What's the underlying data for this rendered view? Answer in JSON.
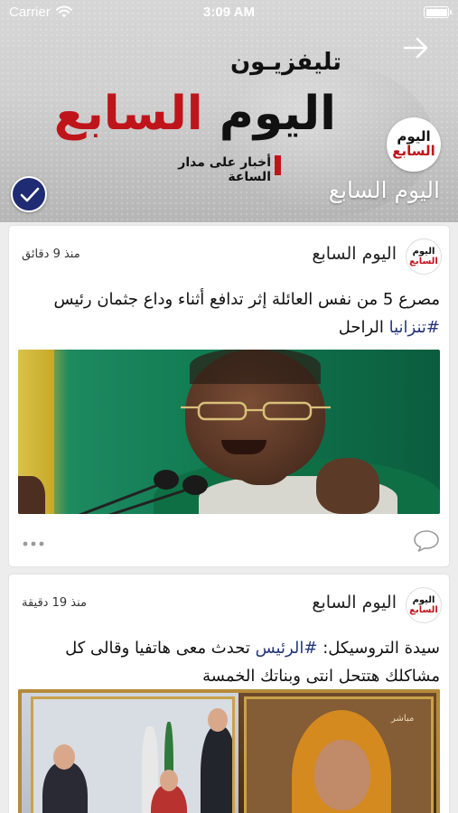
{
  "status_bar": {
    "carrier": "Carrier",
    "time": "3:09 AM"
  },
  "channel": {
    "cover": {
      "tv_label": "تليفزيـون",
      "brand_word_1": "اليوم",
      "brand_word_2": "السابع",
      "tagline": "أخبار على مدار الساعة"
    },
    "avatar_logo": {
      "line_1": "اليوم",
      "line_2": "السابع"
    },
    "name": "اليوم السابع",
    "verified_badge_color": "#1f2b72",
    "share_icon": "arrow-right-icon"
  },
  "posts": [
    {
      "author": "اليوم السابع",
      "avatar_logo": {
        "line_1": "اليوم",
        "line_2": "السابع"
      },
      "time_ago": "منذ 9 دقائق",
      "text": "مصرع 5 من نفس العائلة إثر تدافع أثناء وداع جثمان رئيس",
      "hashtag": "#تنزانيا",
      "text_after": "الراحل",
      "more_icon": "more-dots-icon",
      "comment_icon": "comment-bubble-icon"
    },
    {
      "author": "اليوم السابع",
      "avatar_logo": {
        "line_1": "اليوم",
        "line_2": "السابع"
      },
      "time_ago": "منذ 19 دقيقة",
      "text_before": "سيدة التروسيكل:",
      "hashtag": "#الرئيس",
      "text_after": "تحدث معى هاتفيا وقالى كل مشاكلك هتتحل انتى وبناتك الخمسة",
      "image_stamp": "مباشر"
    }
  ],
  "colors": {
    "accent_red": "#c0141b",
    "hashtag": "#25367a",
    "feed_background": "#ededed"
  }
}
